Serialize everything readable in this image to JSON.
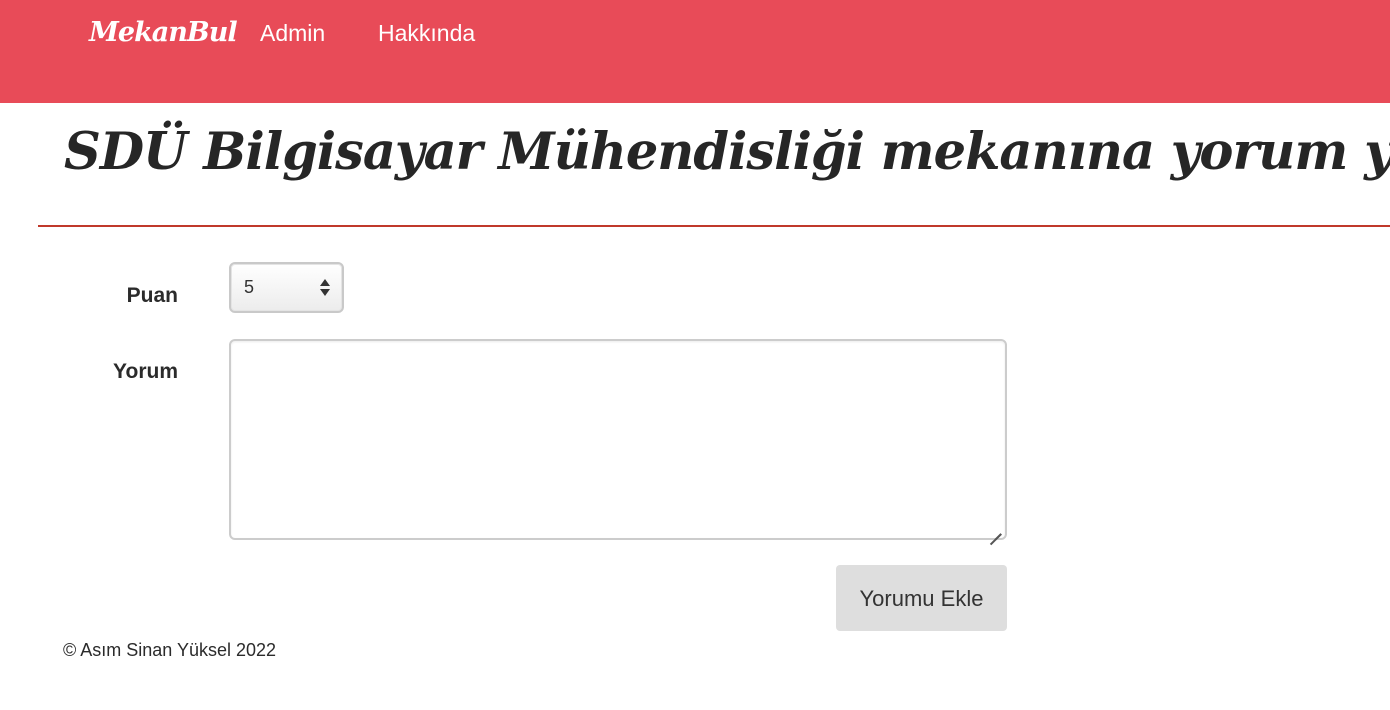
{
  "navbar": {
    "brand": "MekanBul",
    "links": [
      {
        "label": "Admin"
      },
      {
        "label": "Hakkında"
      }
    ],
    "background_color": "#e84b58"
  },
  "page": {
    "title": "SDÜ Bilgisayar Mühendisliği mekanına yorum yap",
    "divider_color": "#c0392b"
  },
  "form": {
    "rating_label": "Puan",
    "rating_value": "5",
    "comment_label": "Yorum",
    "comment_value": "",
    "submit_label": "Yorumu Ekle"
  },
  "footer": {
    "text": "© Asım Sinan Yüksel 2022"
  }
}
